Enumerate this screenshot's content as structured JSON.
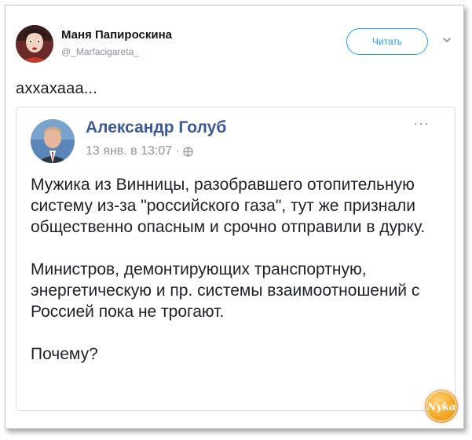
{
  "tweet": {
    "author_name": "Маня Папироскина",
    "author_handle": "@_Marfacigareta_",
    "follow_label": "Читать",
    "text": "аххахааа..."
  },
  "embed": {
    "author_name": "Александр Голуб",
    "date": "13 янв. в 13:07 ·",
    "dots": "···",
    "paragraphs": [
      "Мужика из Винницы, разобравшего отопительную систему из-за \"российского газа\", тут же признали общественно опасным и срочно отправили в дурку.",
      "Министров, демонтирующих транспортную, энергетическую и пр. системы взаимоотношений с Россией пока не трогают.",
      "Почему?"
    ]
  },
  "watermark": {
    "text": "Nyka"
  },
  "colors": {
    "follow_accent": "#1da1f2",
    "embed_author": "#3b5998",
    "meta_gray": "#90949c",
    "watermark_orange": "#f5a623"
  }
}
